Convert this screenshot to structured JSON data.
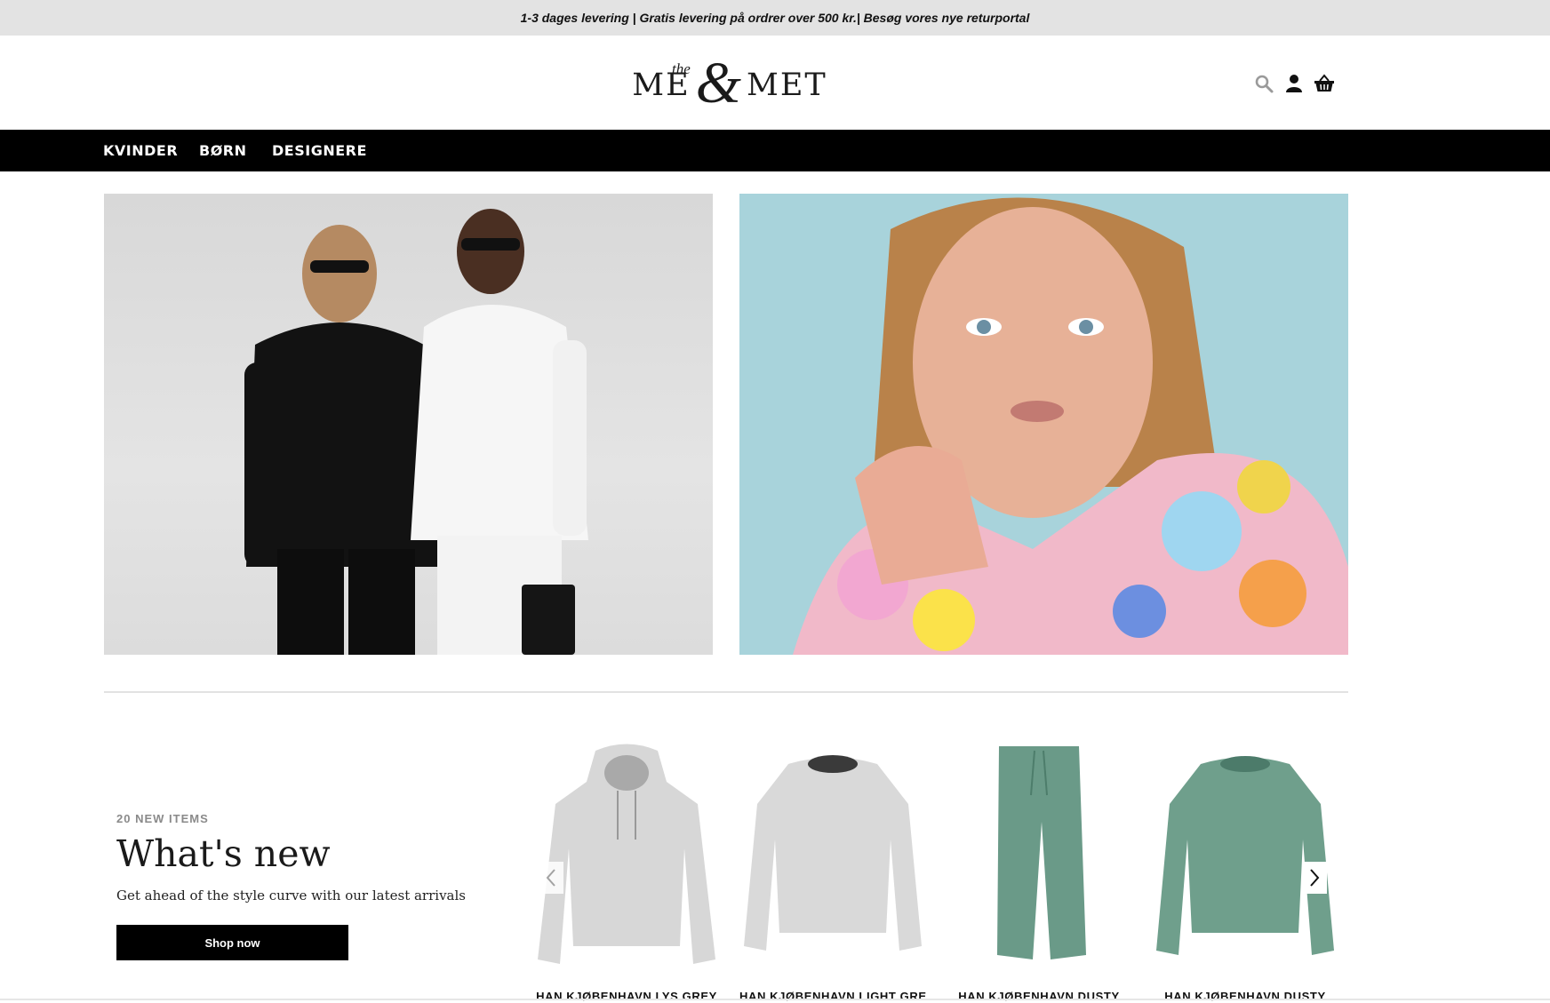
{
  "announcement": "1-3 dages levering | Gratis levering på ordrer over 500 kr.| Besøg vores nye returportal",
  "logo": {
    "me": "ME",
    "amp": "&",
    "the": "the",
    "met": "MET"
  },
  "header_icons": [
    "search-icon",
    "account-icon",
    "basket-icon"
  ],
  "nav": {
    "items": [
      "KVINDER",
      "BØRN",
      "DESIGNERE"
    ]
  },
  "promo": {
    "count": "20 NEW ITEMS",
    "title": "What's new",
    "subtitle": "Get ahead of the style curve with our latest arrivals",
    "button": "Shop now"
  },
  "products": [
    {
      "name": "HAN KJØBENHAVN LYS GREY",
      "color": "#d7d7d7"
    },
    {
      "name": "HAN KJØBENHAVN LIGHT GREY",
      "color": "#d9d9d9"
    },
    {
      "name": "HAN KJØBENHAVN DUSTY",
      "color": "#6a9a88"
    },
    {
      "name": "HAN KJØBENHAVN DUSTY",
      "color": "#6f9f8c"
    }
  ],
  "colors": {
    "topbar": "#e3e3e3",
    "nav": "#000000",
    "button": "#000000"
  }
}
